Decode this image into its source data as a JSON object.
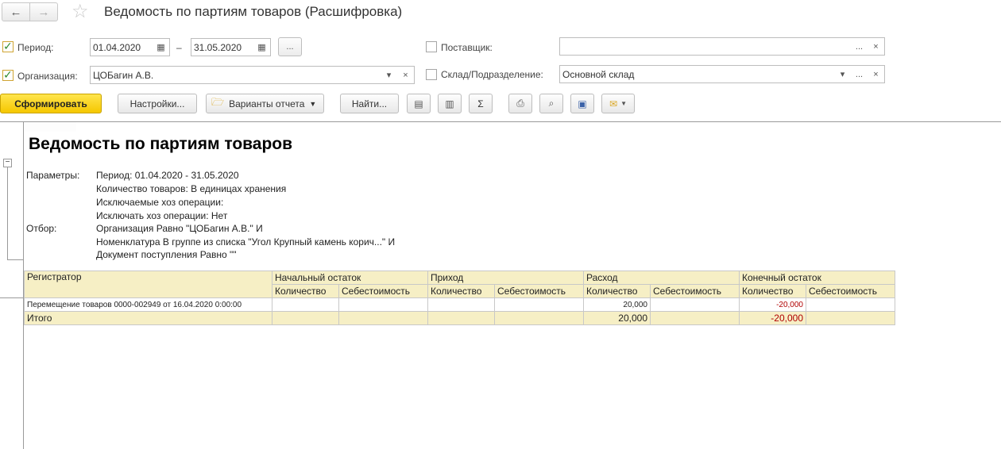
{
  "window": {
    "title": "Ведомость по партиям товаров (Расшифровка)",
    "back_icon": "🡐",
    "forward_icon": "🡒"
  },
  "filters": {
    "period_label": "Период:",
    "period_from": "01.04.2020",
    "period_dash": "–",
    "period_to": "31.05.2020",
    "more_label": "...",
    "org_label": "Организация:",
    "org_value": "ЦОБагин А.В.",
    "supplier_label": "Поставщик:",
    "supplier_value": "",
    "warehouse_label": "Склад/Подразделение:",
    "warehouse_value": "Основной склад",
    "clear_glyph": "×",
    "dots_glyph": "...",
    "dropdown_glyph": "▾"
  },
  "toolbar": {
    "generate_label": "Сформировать",
    "settings_label": "Настройки...",
    "variants_label": "Варианты отчета",
    "find_label": "Найти...",
    "sum_glyph": "Σ"
  },
  "report": {
    "title": "Ведомость по партиям товаров",
    "params_label": "Параметры:",
    "params": [
      "Период: 01.04.2020 - 31.05.2020",
      "Количество товаров: В единицах хранения",
      "Исключаемые хоз операции:",
      "Исключать хоз операции: Нет"
    ],
    "filter_label": "Отбор:",
    "filters": [
      "Организация Равно \"ЦОБагин А.В.\" И",
      "Номенклатура В группе из списка \"Угол Крупный камень корич...\" И",
      "Документ поступления Равно \"\""
    ],
    "table": {
      "registrar_header": "Регистратор",
      "groups": [
        "Начальный остаток",
        "Приход",
        "Расход",
        "Конечный остаток"
      ],
      "sub_qty": "Количество",
      "sub_cost": "Себестоимость",
      "rows": [
        {
          "registrar": "Перемещение товаров 0000-002949 от 16.04.2020 0:00:00",
          "open_qty": "",
          "open_cost": "",
          "in_qty": "",
          "in_cost": "",
          "out_qty": "20,000",
          "out_cost": "",
          "close_qty": "-20,000",
          "close_cost": ""
        }
      ],
      "total": {
        "label": "Итого",
        "out_qty": "20,000",
        "close_qty": "-20,000"
      }
    }
  }
}
